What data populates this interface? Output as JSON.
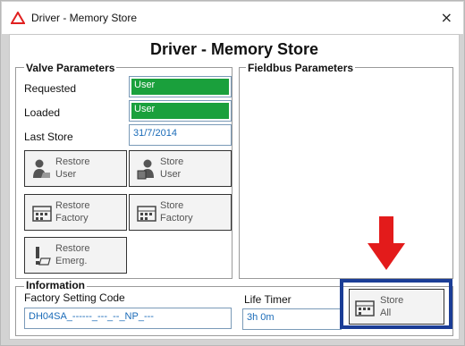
{
  "window": {
    "title": "Driver - Memory Store",
    "heading": "Driver - Memory Store",
    "close_glyph": "×"
  },
  "valve_parameters": {
    "group_title": "Valve Parameters",
    "requested_label": "Requested",
    "requested_value": "User",
    "loaded_label": "Loaded",
    "loaded_value": "User",
    "last_store_label": "Last Store",
    "last_store_value": "31/7/2014"
  },
  "fieldbus_parameters": {
    "group_title": "Fieldbus Parameters"
  },
  "buttons": {
    "restore_user": {
      "line1": "Restore",
      "line2": "User",
      "icon": "user-restore-icon"
    },
    "store_user": {
      "line1": "Store",
      "line2": "User",
      "icon": "user-store-icon"
    },
    "restore_factory": {
      "line1": "Restore",
      "line2": "Factory",
      "icon": "factory-restore-icon"
    },
    "store_factory": {
      "line1": "Store",
      "line2": "Factory",
      "icon": "factory-store-icon"
    },
    "restore_emergency": {
      "line1": "Restore",
      "line2": "Emerg.",
      "icon": "emergency-restore-icon"
    },
    "store_all": {
      "line1": "Store",
      "line2": "All",
      "icon": "store-all-icon"
    }
  },
  "information": {
    "group_title": "Information",
    "factory_code_label": "Factory Setting Code",
    "factory_code_value": "DH04SA_------_---_--_NP_---",
    "life_timer_label": "Life Timer",
    "life_timer_value": "3h 0m"
  },
  "colors": {
    "status_green": "#1aa03c",
    "highlight_blue": "#1b3d96",
    "arrow_red": "#e31b1b"
  }
}
